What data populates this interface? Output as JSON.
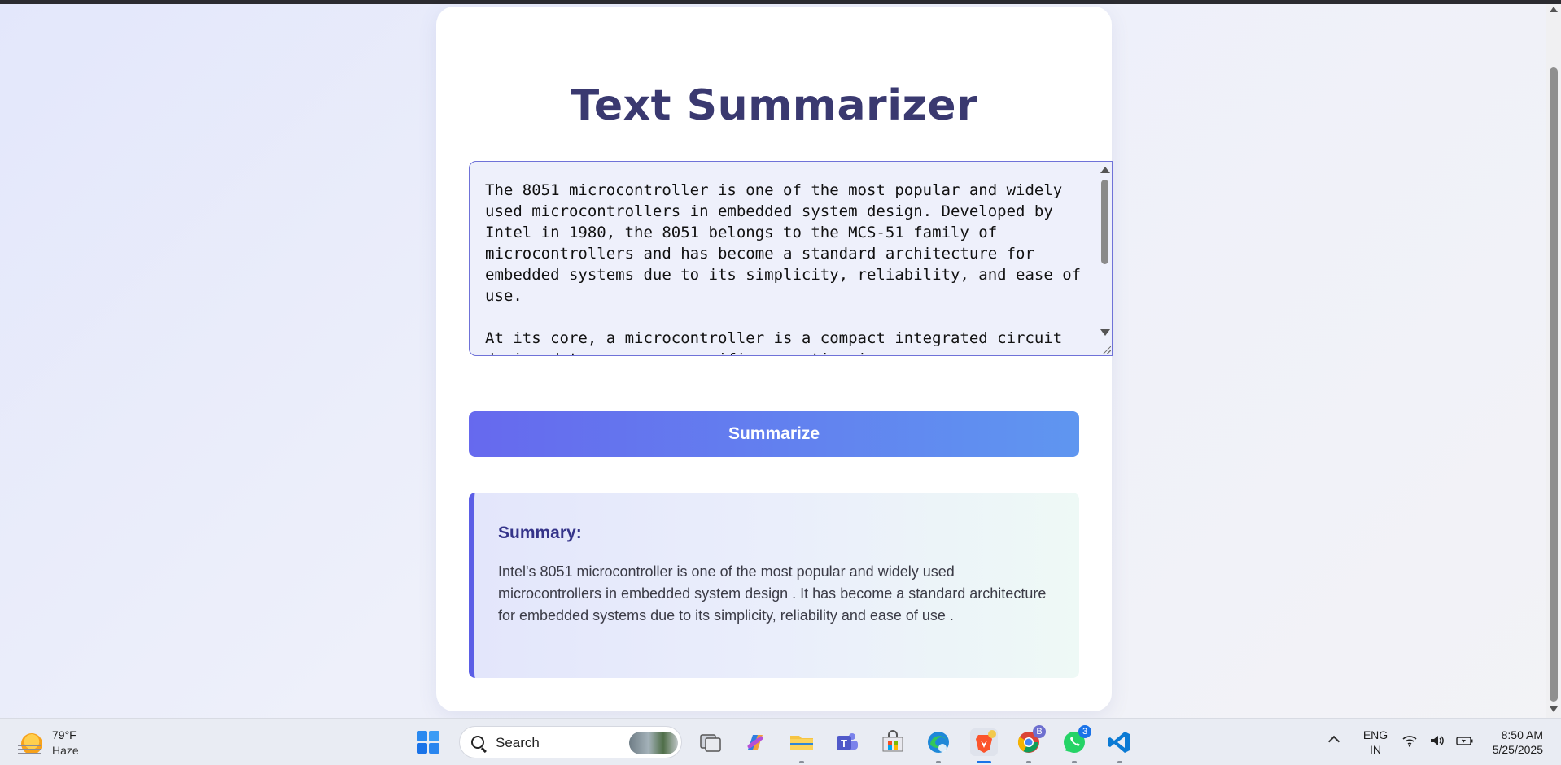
{
  "app": {
    "title": "Text Summarizer"
  },
  "input": {
    "text": "The 8051 microcontroller is one of the most popular and widely used microcontrollers in embedded system design. Developed by Intel in 1980, the 8051 belongs to the MCS-51 family of microcontrollers and has become a standard architecture for embedded systems due to its simplicity, reliability, and ease of use.\n\nAt its core, a microcontroller is a compact integrated circuit designed to govern a specific operation in an"
  },
  "button": {
    "summarize_label": "Summarize"
  },
  "summary": {
    "heading": "Summary:",
    "text": "Intel's 8051 microcontroller is one of the most popular and widely used microcontrollers in embedded system design . It has become a standard architecture for embedded systems due to its simplicity, reliability and ease of use ."
  },
  "colors": {
    "title": "#3a3970",
    "accent": "#5b5ee6",
    "button_gradient_start": "#6669ee",
    "button_gradient_end": "#5f96f0"
  },
  "taskbar": {
    "weather": {
      "temp": "79°F",
      "condition": "Haze"
    },
    "search_label": "Search",
    "apps": [
      {
        "name": "task-view",
        "icon": "task-view-icon"
      },
      {
        "name": "copilot",
        "icon": "copilot-icon"
      },
      {
        "name": "file-explorer",
        "icon": "folder-icon"
      },
      {
        "name": "teams",
        "icon": "teams-icon"
      },
      {
        "name": "microsoft-store",
        "icon": "store-icon"
      },
      {
        "name": "edge",
        "icon": "edge-icon"
      },
      {
        "name": "brave",
        "icon": "brave-icon"
      },
      {
        "name": "chrome",
        "icon": "chrome-icon"
      },
      {
        "name": "whatsapp",
        "icon": "whatsapp-icon",
        "badge": "3"
      },
      {
        "name": "vscode",
        "icon": "vscode-icon"
      }
    ],
    "tray": {
      "lang_line1": "ENG",
      "lang_line2": "IN",
      "time": "8:50 AM",
      "date": "5/25/2025"
    }
  }
}
